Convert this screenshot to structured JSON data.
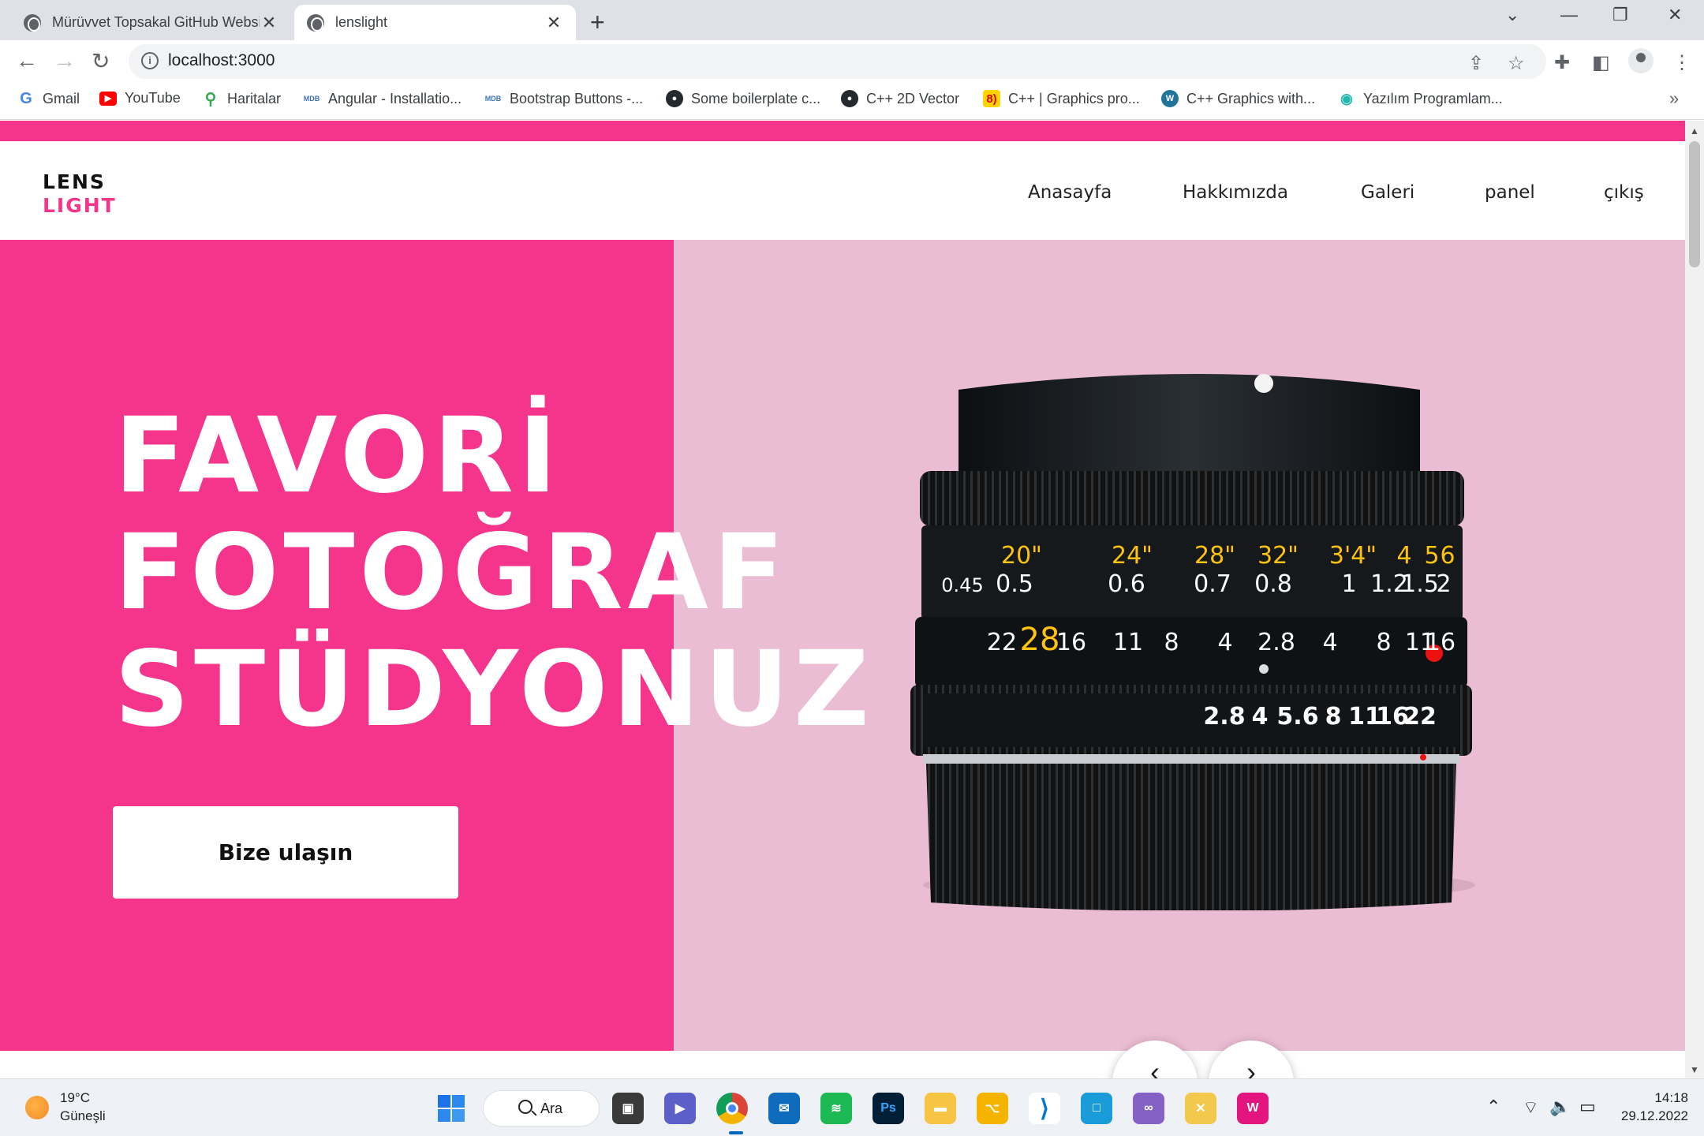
{
  "browser": {
    "tabs": [
      {
        "title": "Mürüvvet Topsakal GitHub Website",
        "active": false
      },
      {
        "title": "lenslight",
        "active": true
      }
    ],
    "url": "localhost:3000",
    "bookmarks": [
      {
        "label": "Gmail",
        "icon": "gmail-icon",
        "color": "#ea4335"
      },
      {
        "label": "YouTube",
        "icon": "youtube-icon",
        "color": "#ff0000"
      },
      {
        "label": "Haritalar",
        "icon": "maps-icon",
        "color": "#34a853"
      },
      {
        "label": "Angular - Installatio...",
        "icon": "mdb-icon",
        "color": "#3b71ca"
      },
      {
        "label": "Bootstrap Buttons -...",
        "icon": "mdb-icon",
        "color": "#3b71ca"
      },
      {
        "label": "Some boilerplate c...",
        "icon": "github-icon",
        "color": "#24292f"
      },
      {
        "label": "C++ 2D Vector",
        "icon": "github-icon",
        "color": "#24292f"
      },
      {
        "label": "C++ | Graphics pro...",
        "icon": "geeks-icon",
        "color": "#e8c400"
      },
      {
        "label": "C++ Graphics with...",
        "icon": "wordpress-icon",
        "color": "#21759b"
      },
      {
        "label": "Yazılım Programlam...",
        "icon": "eye-icon",
        "color": "#22b8b0"
      }
    ]
  },
  "site": {
    "logo_line1": "LENS",
    "logo_line2": "LIGHT",
    "nav": [
      "Anasayfa",
      "Hakkımızda",
      "Galeri",
      "panel",
      "çıkış"
    ],
    "hero_title": [
      "FAVORİ",
      "FOTOĞRAF",
      "STÜDYONUZ"
    ],
    "cta_label": "Bize ulaşın",
    "colors": {
      "brand_pink": "#f5358b",
      "hero_bg": "#ebbdd4"
    },
    "lens_scale": {
      "feet": [
        "20\"",
        "24\"",
        "28\"",
        "32\"",
        "3'4\"",
        "4",
        "5",
        "6"
      ],
      "meters": [
        "0.45",
        "0.5",
        "0.6",
        "0.7",
        "0.8",
        "1",
        "1.2",
        "1.5",
        "2"
      ],
      "depth": [
        "22",
        "28",
        "16",
        "11",
        "8",
        "4",
        "2.8",
        "4",
        "8",
        "11",
        "16"
      ],
      "aperture": [
        "2.8",
        "4",
        "5.6",
        "8",
        "11",
        "16",
        "22"
      ]
    }
  },
  "taskbar": {
    "weather_temp": "19°C",
    "weather_desc": "Güneşli",
    "search_label": "Ara",
    "time": "14:18",
    "date": "29.12.2022",
    "apps": [
      {
        "name": "files-icon",
        "color": "#3a3a3a",
        "glyph": "▣"
      },
      {
        "name": "teams-icon",
        "color": "#5b5fc7",
        "glyph": "▶"
      },
      {
        "name": "chrome-icon",
        "color": "#ffffff",
        "glyph": ""
      },
      {
        "name": "mail-icon",
        "color": "#0f6cbd",
        "glyph": "✉"
      },
      {
        "name": "spotify-icon",
        "color": "#1db954",
        "glyph": "≋"
      },
      {
        "name": "photoshop-icon",
        "color": "#001e36",
        "glyph": "Ps"
      },
      {
        "name": "explorer-icon",
        "color": "#f7c443",
        "glyph": "▬"
      },
      {
        "name": "git-icon",
        "color": "#f4b400",
        "glyph": "⌥"
      },
      {
        "name": "vscode-icon",
        "color": "#ffffff",
        "glyph": "⟩"
      },
      {
        "name": "virtualbox-icon",
        "color": "#1a9cd8",
        "glyph": "□"
      },
      {
        "name": "visualstudio-icon",
        "color": "#8661c5",
        "glyph": "∞"
      },
      {
        "name": "tool-icon",
        "color": "#f2c94c",
        "glyph": "✕"
      },
      {
        "name": "wamp-icon",
        "color": "#e5157f",
        "glyph": "W"
      }
    ]
  }
}
